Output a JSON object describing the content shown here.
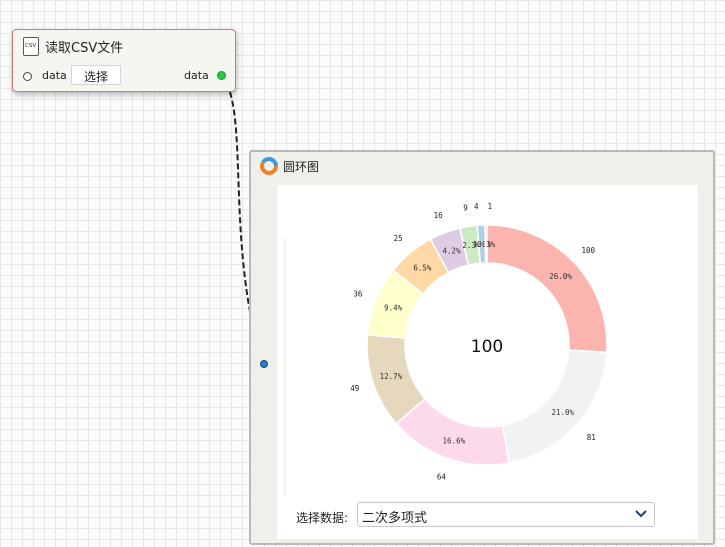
{
  "csv_node": {
    "title": "读取CSV文件",
    "icon": "csv-file-icon",
    "icon_text": "CSV",
    "input_port_label": "data",
    "select_button_label": "选择",
    "output_port_label": "data"
  },
  "donut_node": {
    "title": "圆环图",
    "icon": "donut-chart-icon",
    "select_label": "选择数据:",
    "select_value": "二次多项式"
  },
  "colors": {
    "accent_output_port": "#27c93f",
    "accent_input_port": "#2c78c9",
    "csv_node_border": "#c87d73"
  },
  "chart_data": {
    "type": "pie",
    "center_label": "100",
    "slices": [
      {
        "value": 100,
        "percent_label": "26.0%",
        "color": "#fbb4ae"
      },
      {
        "value": 81,
        "percent_label": "21.0%",
        "color": "#f2f2f2"
      },
      {
        "value": 64,
        "percent_label": "16.6%",
        "color": "#fdd9ec"
      },
      {
        "value": 49,
        "percent_label": "12.7%",
        "color": "#e5d8bd"
      },
      {
        "value": 36,
        "percent_label": "9.4%",
        "color": "#ffffcc"
      },
      {
        "value": 25,
        "percent_label": "6.5%",
        "color": "#fed9a6"
      },
      {
        "value": 16,
        "percent_label": "4.2%",
        "color": "#decbe4"
      },
      {
        "value": 9,
        "percent_label": "2.3%",
        "color": "#ccebc5"
      },
      {
        "value": 4,
        "percent_label": "1.0%",
        "color": "#b3cde3"
      },
      {
        "value": 1,
        "percent_label": "0.3%",
        "color": "#fbb4ae"
      }
    ]
  }
}
